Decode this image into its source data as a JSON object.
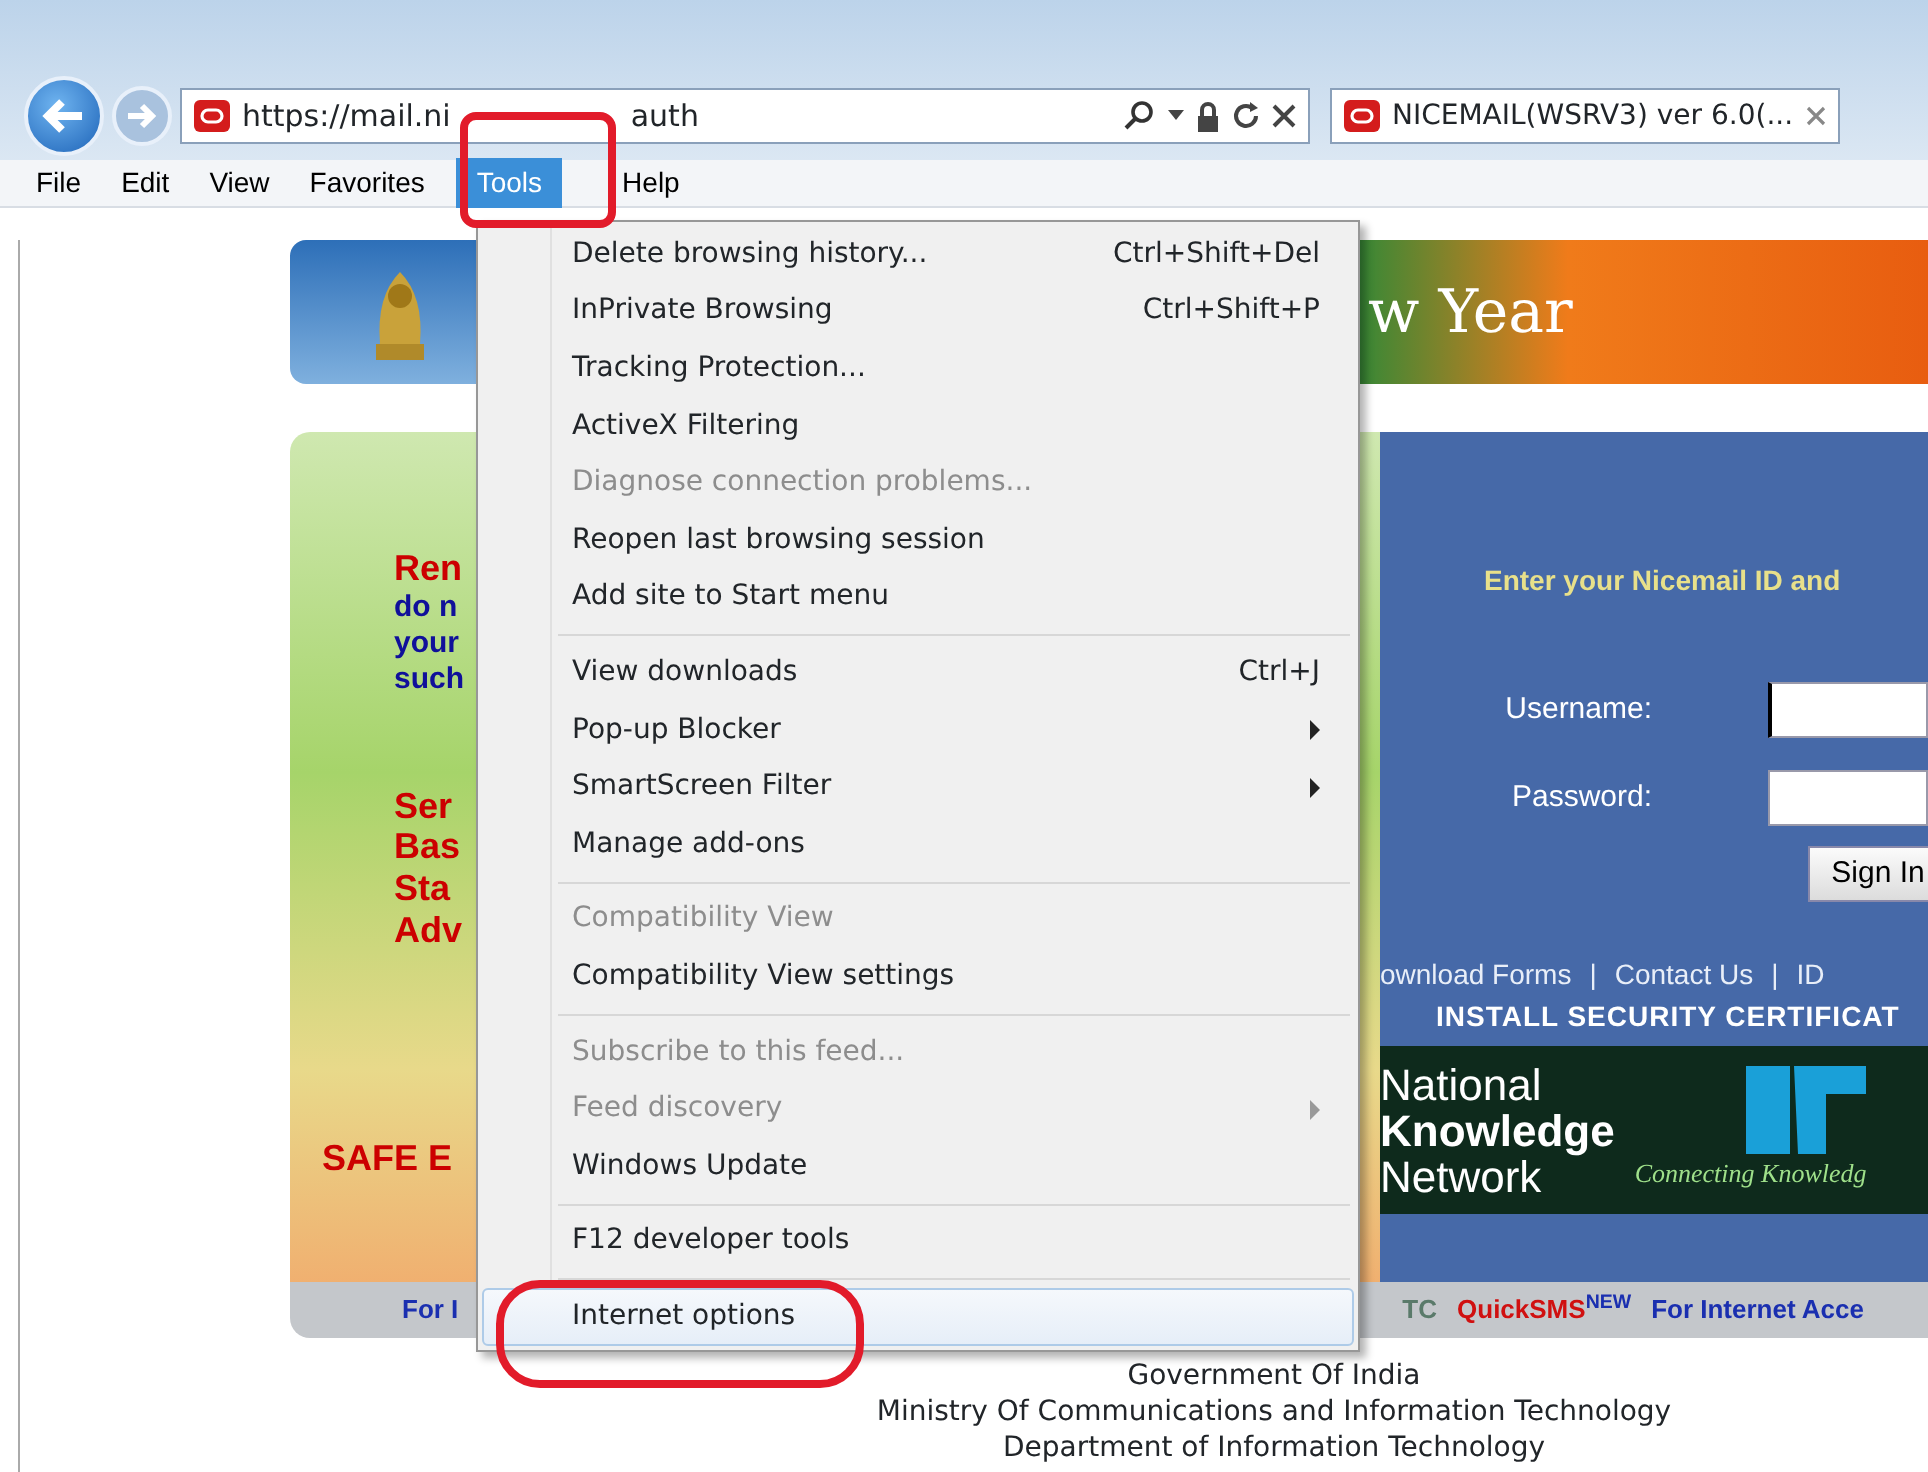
{
  "browser": {
    "address_parts": [
      "https://mail.ni",
      "auth"
    ],
    "tab_title": "NICEMAIL(WSRV3) ver 6.0(...",
    "menubar": [
      {
        "label": "File",
        "selected": false
      },
      {
        "label": "Edit",
        "selected": false
      },
      {
        "label": "View",
        "selected": false
      },
      {
        "label": "Favorites",
        "selected": false
      },
      {
        "label": "Tools",
        "selected": true
      },
      {
        "label": "Help",
        "selected": false
      }
    ]
  },
  "tools_menu": {
    "groups": [
      [
        {
          "label": "Delete browsing history...",
          "shortcut": "Ctrl+Shift+Del",
          "submenu": false,
          "disabled": false,
          "highlighted": false
        },
        {
          "label": "InPrivate Browsing",
          "shortcut": "Ctrl+Shift+P",
          "submenu": false,
          "disabled": false,
          "highlighted": false
        },
        {
          "label": "Tracking Protection...",
          "submenu": false,
          "disabled": false,
          "highlighted": false
        },
        {
          "label": "ActiveX Filtering",
          "submenu": false,
          "disabled": false,
          "highlighted": false
        },
        {
          "label": "Diagnose connection problems...",
          "submenu": false,
          "disabled": true,
          "highlighted": false
        },
        {
          "label": "Reopen last browsing session",
          "submenu": false,
          "disabled": false,
          "highlighted": false
        },
        {
          "label": "Add site to Start menu",
          "submenu": false,
          "disabled": false,
          "highlighted": false
        }
      ],
      [
        {
          "label": "View downloads",
          "shortcut": "Ctrl+J",
          "submenu": false,
          "disabled": false,
          "highlighted": false
        },
        {
          "label": "Pop-up Blocker",
          "submenu": true,
          "disabled": false,
          "highlighted": false
        },
        {
          "label": "SmartScreen Filter",
          "submenu": true,
          "disabled": false,
          "highlighted": false
        },
        {
          "label": "Manage add-ons",
          "submenu": false,
          "disabled": false,
          "highlighted": false
        }
      ],
      [
        {
          "label": "Compatibility View",
          "submenu": false,
          "disabled": true,
          "highlighted": false
        },
        {
          "label": "Compatibility View settings",
          "submenu": false,
          "disabled": false,
          "highlighted": false
        }
      ],
      [
        {
          "label": "Subscribe to this feed...",
          "submenu": false,
          "disabled": true,
          "highlighted": false
        },
        {
          "label": "Feed discovery",
          "submenu": true,
          "disabled": true,
          "highlighted": false
        },
        {
          "label": "Windows Update",
          "submenu": false,
          "disabled": false,
          "highlighted": false
        }
      ],
      [
        {
          "label": "F12 developer tools",
          "submenu": false,
          "disabled": false,
          "highlighted": false
        }
      ],
      [
        {
          "label": "Internet options",
          "submenu": false,
          "disabled": false,
          "highlighted": true
        }
      ]
    ]
  },
  "page": {
    "banner_text": "w Year",
    "left_heading": "Ren",
    "left_lines": [
      "do n",
      "your",
      "such"
    ],
    "left_list": [
      "Ser",
      "Bas",
      "Sta",
      "Adv"
    ],
    "left_footer": "SAFE E",
    "login_prompt": "Enter your Nicemail ID and",
    "username_label": "Username:",
    "password_label": "Password:",
    "sign_in": "Sign In",
    "links": [
      "ownload Forms",
      "Contact Us",
      "ID"
    ],
    "link_separator": "|",
    "certificate": "INSTALL SECURITY CERTIFICAT",
    "nkn": [
      "National",
      "Knowledge",
      "Network"
    ],
    "nkn_tagline": "Connecting Knowledg",
    "strip": [
      {
        "text": "For I",
        "kind": "link"
      },
      {
        "text": "TC",
        "kind": "muted"
      },
      {
        "text": "QuickSMS",
        "sup": "NEW",
        "kind": "hot"
      },
      {
        "text": "For Internet Acce",
        "kind": "link"
      }
    ],
    "footer": [
      "Government Of India",
      "Ministry Of Communications and Information Technology",
      "Department of Information Technology"
    ]
  }
}
